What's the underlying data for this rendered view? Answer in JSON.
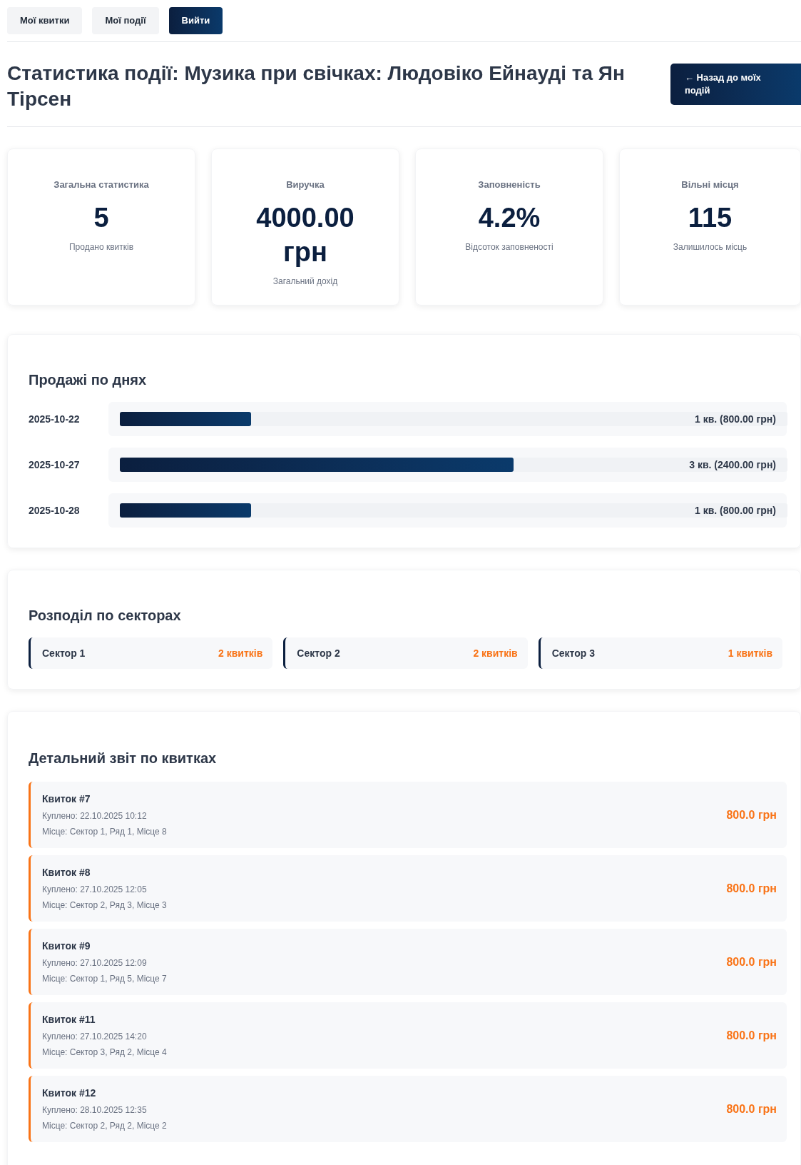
{
  "nav": {
    "tabs": [
      {
        "label": "Мої квитки",
        "selected": false
      },
      {
        "label": "Мої події",
        "selected": false
      },
      {
        "label": "Вийти",
        "selected": true
      }
    ]
  },
  "header": {
    "title": "Статистика події: Музика при свічках: Людовіко Ейнауді та Ян Тірсен",
    "back_button": "← Назад до моїх подій"
  },
  "stats": [
    {
      "label": "Загальна статистика",
      "value": "5",
      "caption": "Продано квитків"
    },
    {
      "label": "Виручка",
      "value": "4000.00 грн",
      "caption": "Загальний дохід"
    },
    {
      "label": "Заповненість",
      "value": "4.2%",
      "caption": "Відсоток заповненості"
    },
    {
      "label": "Вільні місця",
      "value": "115",
      "caption": "Залишилось місць"
    }
  ],
  "sales_by_day": {
    "title": "Продажі по днях",
    "rows": [
      {
        "date": "2025-10-22",
        "level": 0.197,
        "reading": "1 кв. (800.00 грн)"
      },
      {
        "date": "2025-10-27",
        "level": 0.59,
        "reading": "3 кв. (2400.00 грн)"
      },
      {
        "date": "2025-10-28",
        "level": 0.197,
        "reading": "1 кв. (800.00 грн)"
      }
    ]
  },
  "sectors": {
    "title": "Розподіл по секторах",
    "items": [
      {
        "name": "Сектор 1",
        "count": "2 квитків"
      },
      {
        "name": "Сектор 2",
        "count": "2 квитків"
      },
      {
        "name": "Сектор 3",
        "count": "1 квитків"
      }
    ]
  },
  "tickets": {
    "title": "Детальний звіт по квитках",
    "items": [
      {
        "title": "Квиток #7",
        "purchased": "Куплено: 22.10.2025 10:12",
        "seat": "Місце: Сектор 1, Ряд 1, Місце 8",
        "price": "800.0 грн"
      },
      {
        "title": "Квиток #8",
        "purchased": "Куплено: 27.10.2025 12:05",
        "seat": "Місце: Сектор 2, Ряд 3, Місце 3",
        "price": "800.0 грн"
      },
      {
        "title": "Квиток #9",
        "purchased": "Куплено: 27.10.2025 12:09",
        "seat": "Місце: Сектор 1, Ряд 5, Місце 7",
        "price": "800.0 грн"
      },
      {
        "title": "Квиток #11",
        "purchased": "Куплено: 27.10.2025 14:20",
        "seat": "Місце: Сектор 3, Ряд 2, Місце 4",
        "price": "800.0 грн"
      },
      {
        "title": "Квиток #12",
        "purchased": "Куплено: 28.10.2025 12:35",
        "seat": "Місце: Сектор 2, Ряд 2, Місце 2",
        "price": "800.0 грн"
      }
    ]
  }
}
